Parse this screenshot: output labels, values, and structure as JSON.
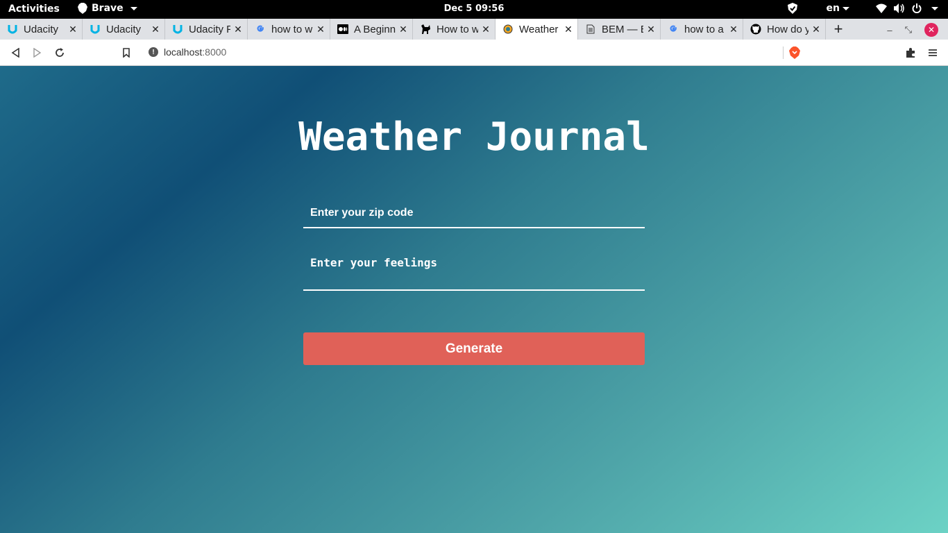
{
  "system_bar": {
    "activities": "Activities",
    "app_name": "Brave",
    "clock": "Dec 5  09:56",
    "language": "en"
  },
  "tabs": [
    {
      "title": "Udacity",
      "favicon": "udacity-icon",
      "active": false
    },
    {
      "title": "Udacity",
      "favicon": "udacity-icon",
      "active": false
    },
    {
      "title": "Udacity F",
      "favicon": "udacity-icon",
      "active": false
    },
    {
      "title": "how to w",
      "favicon": "google-icon",
      "active": false
    },
    {
      "title": "A Beginn",
      "favicon": "medium-icon",
      "active": false
    },
    {
      "title": "How to w",
      "favicon": "dog-icon",
      "active": false
    },
    {
      "title": "Weather",
      "favicon": "weather-icon",
      "active": true
    },
    {
      "title": "BEM — E",
      "favicon": "document-icon",
      "active": false
    },
    {
      "title": "how to a",
      "favicon": "google-icon",
      "active": false
    },
    {
      "title": "How do y",
      "favicon": "github-icon",
      "active": false
    }
  ],
  "toolbar": {
    "url_host": "localhost",
    "url_port": ":8000"
  },
  "page": {
    "title": "Weather Journal",
    "zip_placeholder": "Enter your zip code",
    "feelings_placeholder": "Enter your feelings",
    "generate_label": "Generate"
  },
  "colors": {
    "button": "#e06158",
    "gradient_dark": "#104f76",
    "gradient_light": "#6cd2c5"
  }
}
